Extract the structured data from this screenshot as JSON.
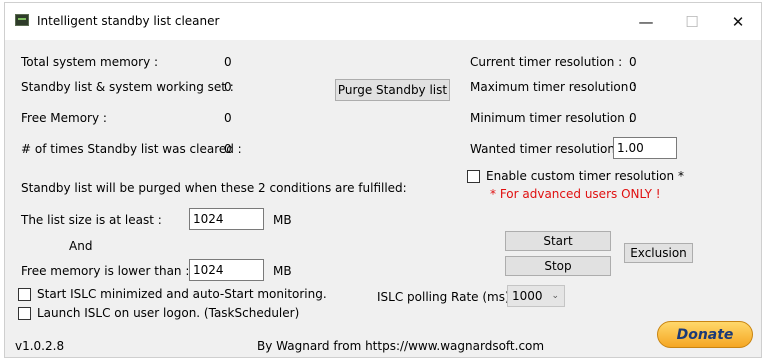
{
  "window": {
    "title": "Intelligent standby list cleaner"
  },
  "left": {
    "total_memory_label": "Total system memory :",
    "total_memory_value": "0",
    "standby_label": "Standby list & system working set :",
    "standby_value": "0",
    "free_memory_label": "Free Memory :",
    "free_memory_value": "0",
    "cleared_label": "# of times Standby list was cleared :",
    "cleared_value": "0",
    "purge_button": "Purge Standby list",
    "conditions_text": "Standby list will be purged when these 2 conditions are fulfilled:",
    "list_size_label": "The list size is at least :",
    "list_size_value": "1024",
    "list_size_unit": "MB",
    "and_label": "And",
    "free_lower_label": "Free memory is lower than :",
    "free_lower_value": "1024",
    "free_lower_unit": "MB",
    "start_minimized_label": "Start ISLC minimized and auto-Start monitoring.",
    "launch_logon_label": "Launch ISLC on user logon. (TaskScheduler)"
  },
  "right": {
    "current_timer_label": "Current timer resolution :",
    "current_timer_value": "0",
    "max_timer_label": "Maximum timer resolution :",
    "max_timer_value": "0",
    "min_timer_label": "Minimum timer resolution :",
    "min_timer_value": "0",
    "wanted_timer_label": "Wanted timer resolution :",
    "wanted_timer_value": "1.00",
    "custom_timer_label": "Enable custom timer resolution *",
    "advanced_note": "* For advanced users ONLY !",
    "start_button": "Start",
    "stop_button": "Stop",
    "exclusion_button": "Exclusion",
    "polling_label": "ISLC polling Rate (ms):",
    "polling_value": "1000"
  },
  "footer": {
    "version": "v1.0.2.8",
    "credit": "By Wagnard from https://www.wagnardsoft.com",
    "donate_label": "Donate"
  }
}
